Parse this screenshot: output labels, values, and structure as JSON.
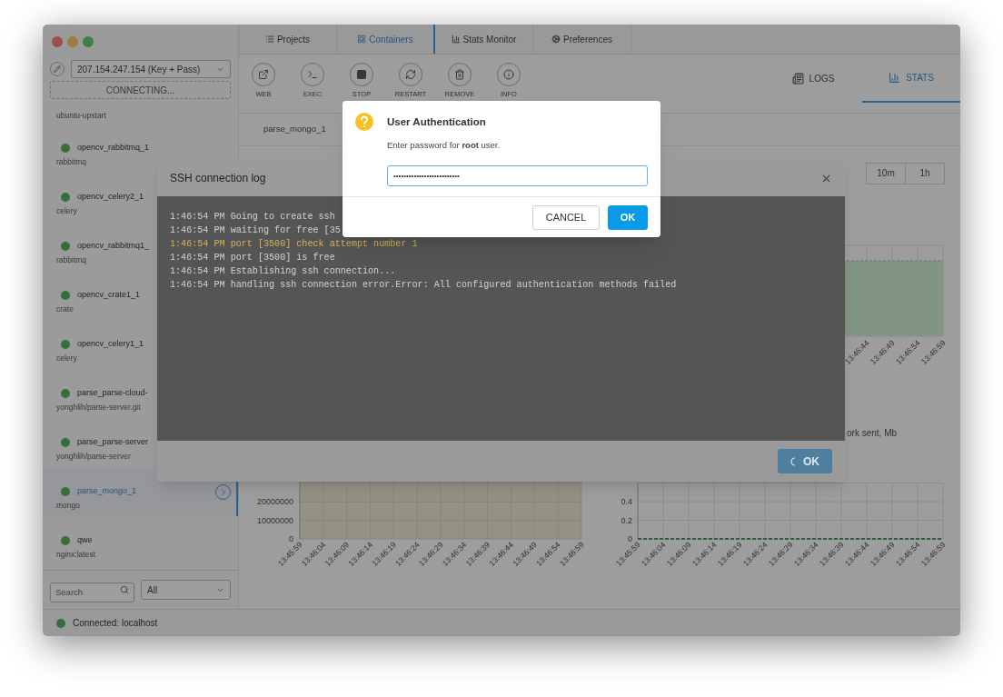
{
  "sidebar": {
    "host_select": {
      "value": "207.154.247.154 (Key + Pass)"
    },
    "connect_button": {
      "label": "CONNECTING..."
    },
    "partial_item": {
      "subtitle": "ubuntu-upstart"
    },
    "containers": [
      {
        "name": "opencv_rabbitmq_1",
        "subtitle": "rabbitmq",
        "selected": false
      },
      {
        "name": "opencv_celery2_1",
        "subtitle": "celery",
        "selected": false
      },
      {
        "name": "opencv_rabbitmq1_",
        "subtitle": "rabbitmq",
        "selected": false
      },
      {
        "name": "opencv_crate1_1",
        "subtitle": "crate",
        "selected": false
      },
      {
        "name": "opencv_celery1_1",
        "subtitle": "celery",
        "selected": false
      },
      {
        "name": "parse_parse-cloud-",
        "subtitle": "yonghlih/parse-server.git",
        "selected": false
      },
      {
        "name": "parse_parse-server",
        "subtitle": "yonghlih/parse-server",
        "selected": false
      },
      {
        "name": "parse_mongo_1",
        "subtitle": "mongo",
        "selected": true
      },
      {
        "name": "qwe",
        "subtitle": "nginx:latest",
        "selected": false
      }
    ],
    "search": {
      "placeholder": "Search"
    },
    "filter": {
      "value": "All"
    }
  },
  "tabs": [
    {
      "label": "Projects",
      "kind": "list",
      "selected": false
    },
    {
      "label": "Containers",
      "kind": "grid",
      "selected": true
    },
    {
      "label": "Stats Monitor",
      "kind": "bars",
      "selected": false
    },
    {
      "label": "Preferences",
      "kind": "gears",
      "selected": false
    }
  ],
  "toolbar": [
    {
      "label": "WEB",
      "kind": "web"
    },
    {
      "label": "EXEC",
      "kind": "exec"
    },
    {
      "label": "STOP",
      "kind": "stop"
    },
    {
      "label": "RESTART",
      "kind": "restart"
    },
    {
      "label": "REMOVE",
      "kind": "remove"
    },
    {
      "label": "INFO",
      "kind": "info"
    }
  ],
  "views": [
    {
      "label": "LOGS",
      "kind": "logs",
      "selected": false
    },
    {
      "label": "STATS",
      "kind": "stats",
      "selected": true
    }
  ],
  "container_name": "parse_mongo_1",
  "time_ranges": [
    "10m",
    "1h"
  ],
  "charts": {
    "top_right": {
      "x_labels": [
        "13:46:44",
        "13:46:49",
        "13:46:54",
        "13:46:59"
      ]
    },
    "bottom_left": {
      "y_labels": [
        "20000000",
        "10000000",
        "0"
      ],
      "x_labels": [
        "13:45:59",
        "13:46:04",
        "13:46:09",
        "13:46:14",
        "13:46:19",
        "13:46:24",
        "13:46:29",
        "13:46:34",
        "13:46:39",
        "13:46:44",
        "13:46:49",
        "13:46:54",
        "13:46:59"
      ]
    },
    "bottom_right": {
      "chart_data": {
        "type": "line",
        "title": "ork sent, Mb",
        "categories": [
          "13:45:59",
          "13:46:04",
          "13:46:09",
          "13:46:14",
          "13:46:19",
          "13:46:24",
          "13:46:29",
          "13:46:34",
          "13:46:39",
          "13:46:44",
          "13:46:49",
          "13:46:54",
          "13:46:59"
        ],
        "series": [
          {
            "color": "#2e7d32",
            "line_style": "dashed",
            "values": [
              0,
              0,
              0,
              0,
              0,
              0,
              0,
              0,
              0,
              0,
              0,
              0,
              0
            ]
          }
        ],
        "ylim": [
          0,
          0.6
        ],
        "yticks": [
          0,
          0.2,
          0.4
        ]
      }
    }
  },
  "status_bar": {
    "text": "Connected: localhost"
  },
  "ssh_log": {
    "title": "SSH connection log",
    "lines": [
      {
        "text": "1:46:54 PM Going to create ssh",
        "kind": "info"
      },
      {
        "text": "1:46:54 PM waiting for free [35",
        "kind": "info"
      },
      {
        "text": "1:46:54 PM port [3500] check attempt number 1",
        "kind": "warn"
      },
      {
        "text": "1:46:54 PM port [3500] is free",
        "kind": "info"
      },
      {
        "text": "1:46:54 PM Establishing ssh connection...",
        "kind": "info"
      },
      {
        "text": "1:46:54 PM handling ssh connection error.Error: All configured authentication methods failed",
        "kind": "info"
      }
    ],
    "ok_button": "OK"
  },
  "auth_dialog": {
    "title": "User Authentication",
    "message": "Enter password for **root** user.",
    "password": "••••••••••••••••••••••••••",
    "buttons": [
      {
        "label": "CANCEL",
        "kind": "secondary"
      },
      {
        "label": "OK",
        "kind": "primary"
      }
    ]
  }
}
